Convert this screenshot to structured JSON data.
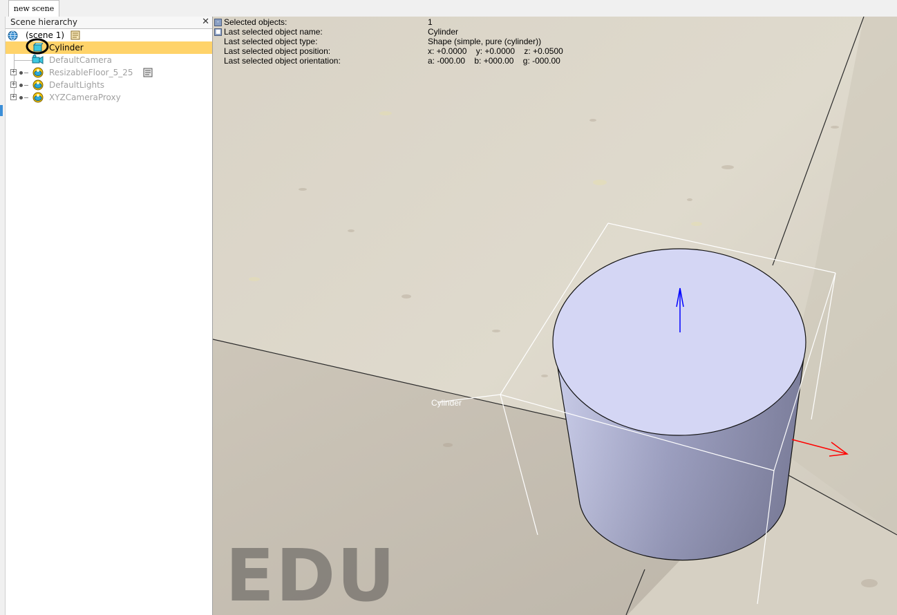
{
  "tabs": [
    {
      "label": "new scene"
    }
  ],
  "hierarchy": {
    "title": "Scene hierarchy",
    "close_symbol": "✕",
    "scene_label": "(scene 1)",
    "items": [
      {
        "label": "Cylinder",
        "icon": "cylinder-shape-icon",
        "selected": true
      },
      {
        "label": "DefaultCamera",
        "icon": "camera-icon"
      },
      {
        "label": "ResizableFloor_5_25",
        "icon": "model-icon"
      },
      {
        "label": "DefaultLights",
        "icon": "model-icon"
      },
      {
        "label": "XYZCameraProxy",
        "icon": "model-icon"
      }
    ]
  },
  "info_overlay": {
    "rows": [
      {
        "label": "Selected objects:",
        "value": "1"
      },
      {
        "label": "Last selected object name:",
        "value": "Cylinder"
      },
      {
        "label": "Last selected object type:",
        "value": "Shape (simple, pure (cylinder))"
      },
      {
        "label": "Last selected object position:",
        "value": "x: +0.0000    y: +0.0000    z: +0.0500"
      },
      {
        "label": "Last selected object orientation:",
        "value": "a: -000.00    b: +000.00    g: -000.00"
      }
    ]
  },
  "viewport": {
    "object_label": "Cylinder",
    "watermark": "EDU",
    "colors": {
      "selection_highlight": "#ffd36a",
      "cylinder_top": "#d4d6f4",
      "x_axis": "#ff0000",
      "z_axis": "#0000ff"
    }
  }
}
